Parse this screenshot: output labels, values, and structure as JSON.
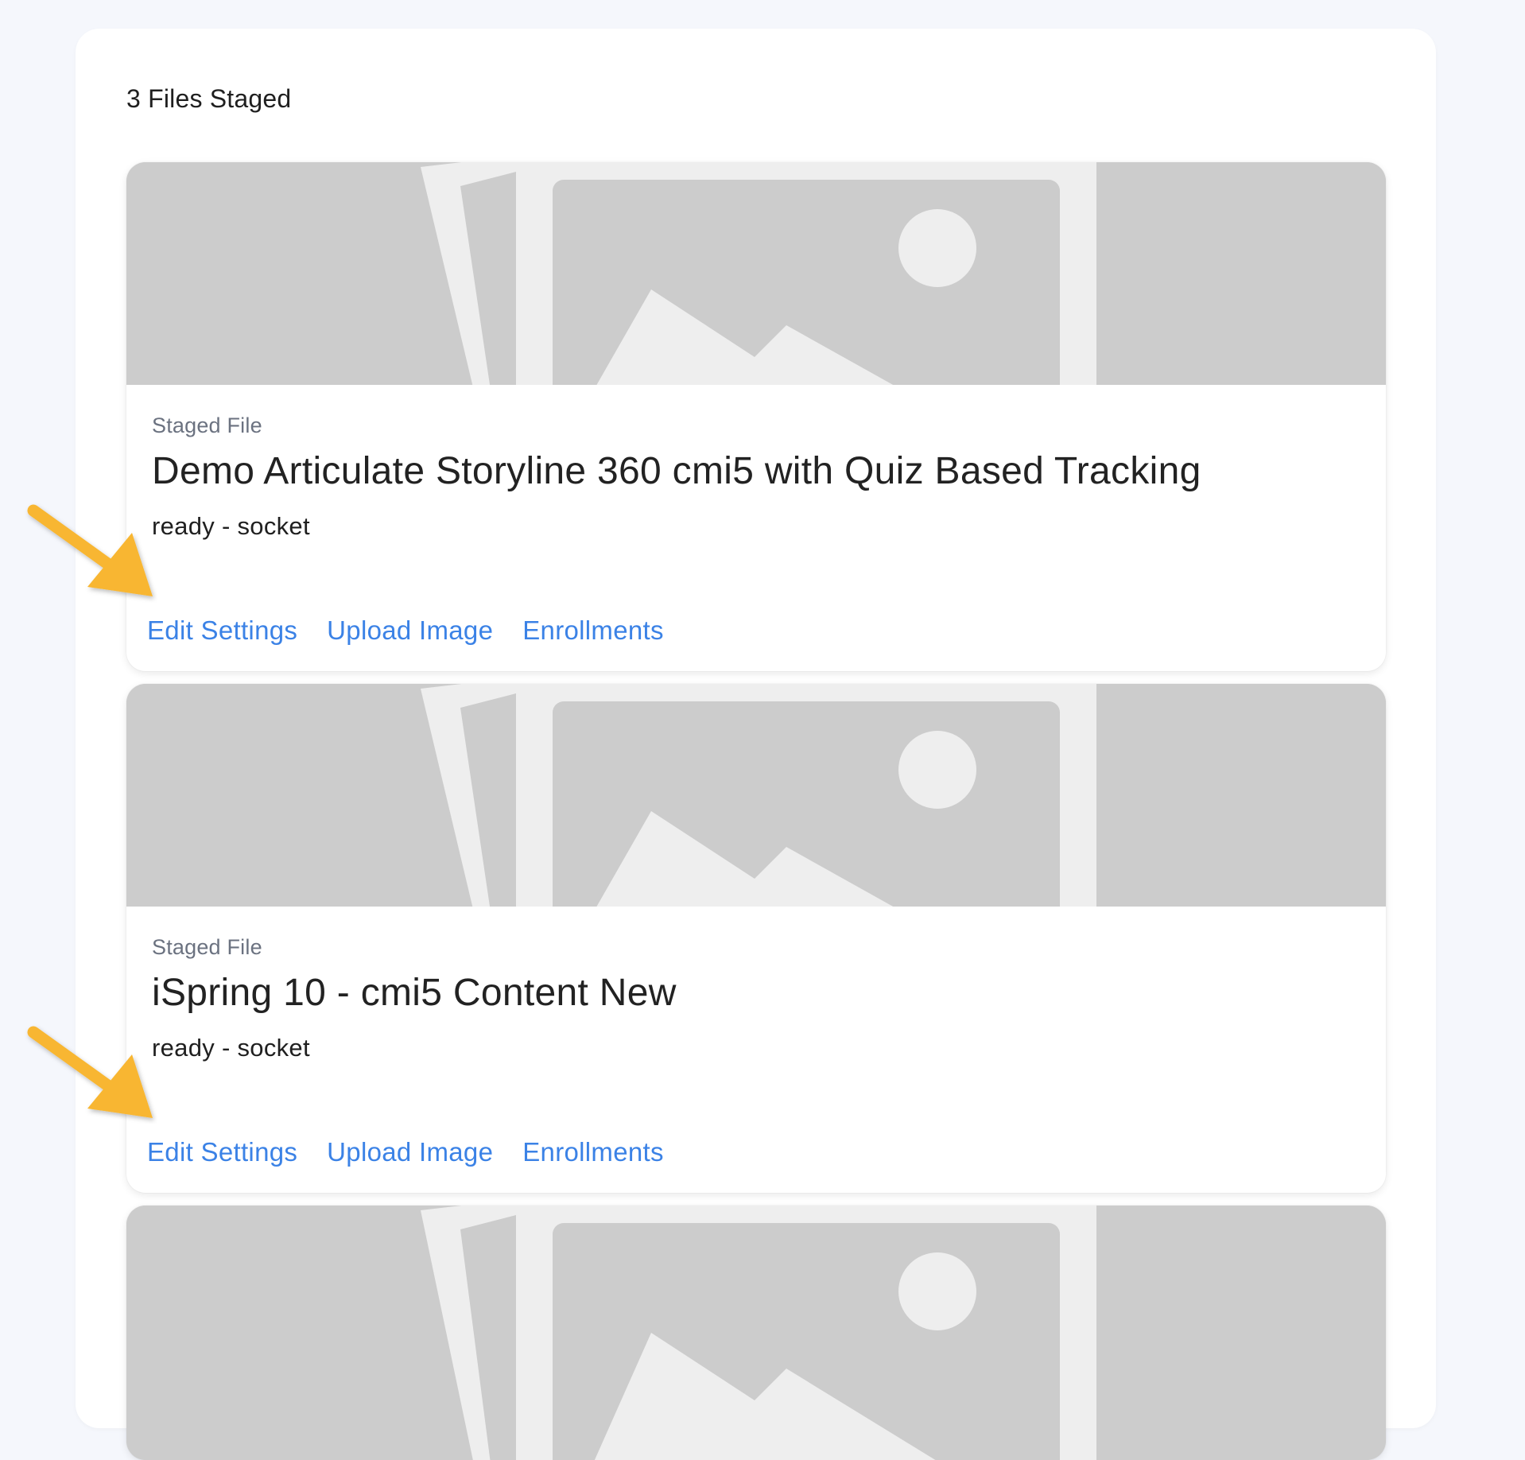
{
  "header": {
    "staged_count_label": "3 Files Staged"
  },
  "colors": {
    "page_background": "#f5f7fc",
    "placeholder_gray": "#cccccc",
    "placeholder_light": "#eeeeee",
    "link_blue": "#3b82e6",
    "arrow_annotation": "#f8b630"
  },
  "files": [
    {
      "eyebrow": "Staged File",
      "title": "Demo Articulate Storyline 360 cmi5 with Quiz Based Tracking",
      "status": "ready - socket",
      "actions": [
        "Edit Settings",
        "Upload Image",
        "Enrollments"
      ]
    },
    {
      "eyebrow": "Staged File",
      "title": "iSpring 10 - cmi5 Content New",
      "status": "ready - socket",
      "actions": [
        "Edit Settings",
        "Upload Image",
        "Enrollments"
      ]
    },
    {
      "eyebrow": "",
      "title": "",
      "status": "",
      "actions": []
    }
  ],
  "icons": {
    "thumbnail_placeholder": "image-placeholder-icon",
    "annotation_arrow": "arrow-annotation-icon"
  }
}
